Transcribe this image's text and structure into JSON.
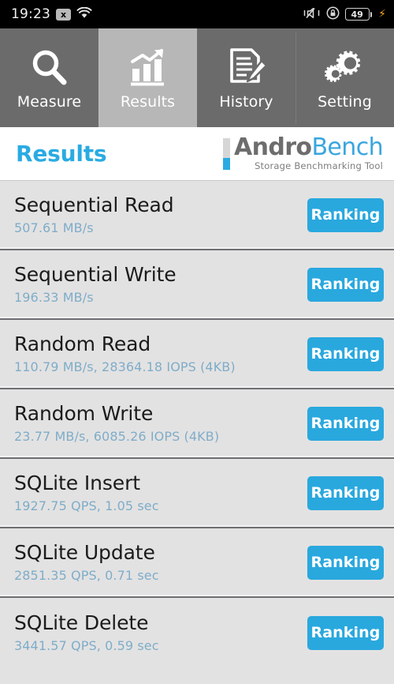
{
  "statusbar": {
    "time": "19:23",
    "sim_icon": "sim-x-icon",
    "sim_glyph": "x",
    "wifi_icon": "wifi-icon",
    "vibrate_icon": "vibrate-mute-icon",
    "lock_icon": "screen-lock-rotation-icon",
    "battery_icon": "battery-icon",
    "battery_level": "49",
    "charging_icon": "charging-bolt-icon",
    "charging_glyph": "⚡"
  },
  "tabs": [
    {
      "label": "Measure",
      "icon": "magnifier-icon",
      "active": false
    },
    {
      "label": "Results",
      "icon": "bar-chart-arrow-icon",
      "active": true
    },
    {
      "label": "History",
      "icon": "document-pencil-icon",
      "active": false
    },
    {
      "label": "Setting",
      "icon": "gears-icon",
      "active": false
    }
  ],
  "header": {
    "title": "Results",
    "logo": {
      "part1": "Andro",
      "part2": "Bench",
      "tagline": "Storage Benchmarking Tool"
    }
  },
  "results": {
    "button_label": "Ranking",
    "rows": [
      {
        "title": "Sequential Read",
        "value": "507.61 MB/s"
      },
      {
        "title": "Sequential Write",
        "value": "196.33 MB/s"
      },
      {
        "title": "Random Read",
        "value": "110.79 MB/s, 28364.18 IOPS (4KB)"
      },
      {
        "title": "Random Write",
        "value": "23.77 MB/s, 6085.26 IOPS (4KB)"
      },
      {
        "title": "SQLite Insert",
        "value": "1927.75 QPS, 1.05 sec"
      },
      {
        "title": "SQLite Update",
        "value": "2851.35 QPS, 0.71 sec"
      },
      {
        "title": "SQLite Delete",
        "value": "3441.57 QPS, 0.59 sec"
      }
    ]
  },
  "colors": {
    "accent_blue": "#29a8de",
    "subtitle_blue": "#7eadc9",
    "tab_inactive": "#6b6b6b",
    "tab_active": "#b7b7b7",
    "list_bg": "#e3e2e2"
  }
}
